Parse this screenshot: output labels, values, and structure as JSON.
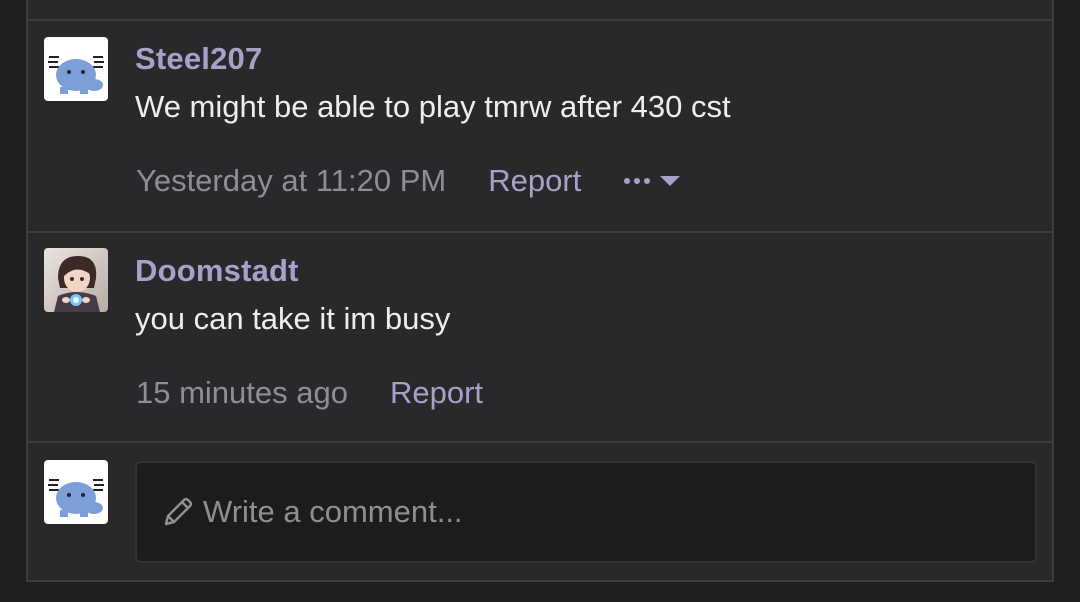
{
  "comments": [
    {
      "username": "Steel207",
      "text": "We might be able to play tmrw after 430 cst",
      "timestamp": "Yesterday at 11:20 PM",
      "report_label": "Report",
      "more_label": "•••",
      "avatar": "axolotl-avatar"
    },
    {
      "username": "Doomstadt",
      "text": "you can take it im busy",
      "timestamp": "15 minutes ago",
      "report_label": "Report",
      "avatar": "anime-character-avatar"
    }
  ],
  "composer": {
    "placeholder": "Write a comment...",
    "icon": "pencil-icon",
    "avatar": "axolotl-avatar"
  },
  "colors": {
    "background": "#1e1e1f",
    "panel": "#29292b",
    "border": "#3e3e41",
    "username": "#a8a0c8",
    "link": "#a8a0c8",
    "body_text": "#eeeeee",
    "muted": "#8f8f93"
  }
}
